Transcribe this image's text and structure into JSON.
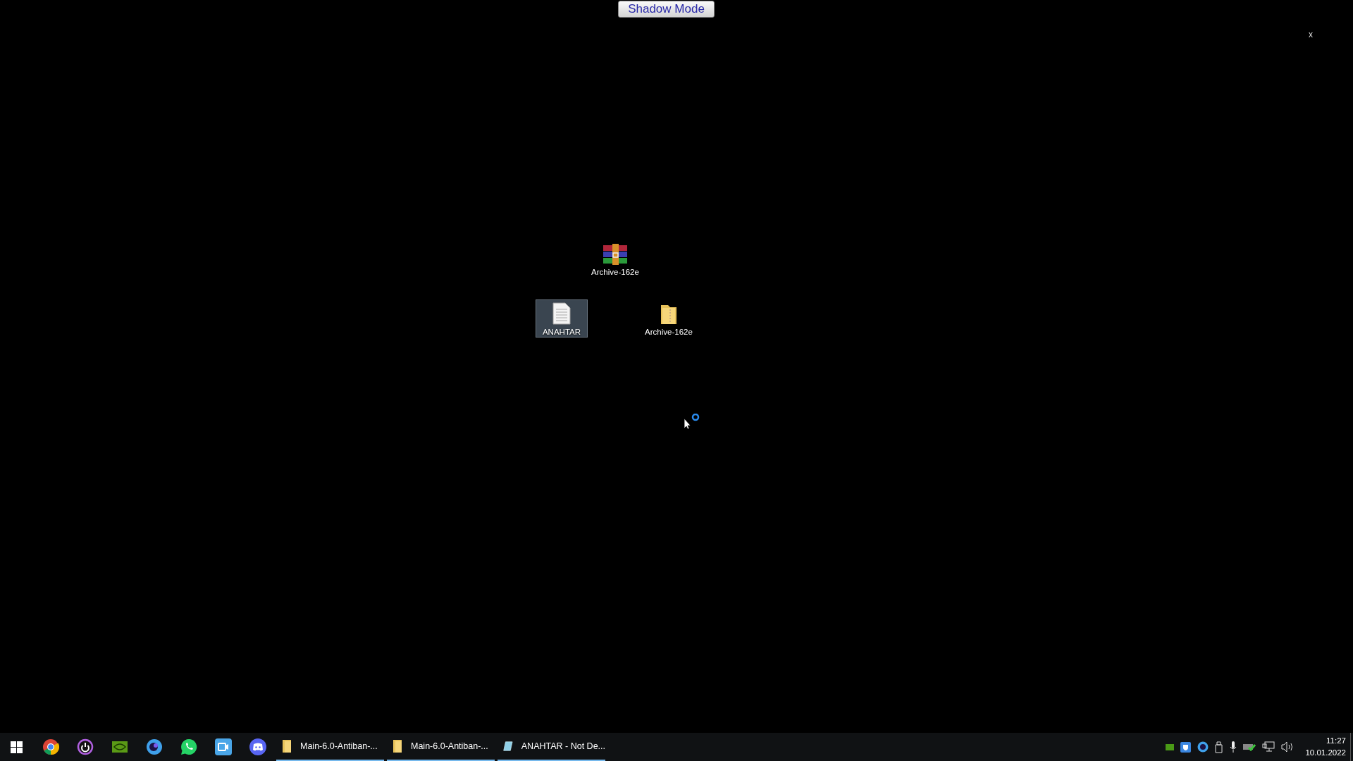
{
  "top_button": {
    "label": "Shadow Mode"
  },
  "close_label": "x",
  "desktop_icons": [
    {
      "kind": "archive",
      "label": "Archive-162e",
      "selected": false
    },
    {
      "kind": "text",
      "label": "ANAHTAR",
      "selected": true
    },
    {
      "kind": "folder",
      "label": "Archive-162e",
      "selected": false
    }
  ],
  "taskbar": {
    "pinned": [
      {
        "kind": "chrome"
      },
      {
        "kind": "ring"
      },
      {
        "kind": "green"
      },
      {
        "kind": "blue-eye"
      },
      {
        "kind": "phone"
      },
      {
        "kind": "camera"
      },
      {
        "kind": "chat"
      }
    ],
    "windows": [
      {
        "kind": "folder",
        "label": "Main-6.0-Antiban-..."
      },
      {
        "kind": "folder",
        "label": "Main-6.0-Antiban-..."
      },
      {
        "kind": "notepad",
        "label": "ANAHTAR - Not De..."
      }
    ],
    "tray": [
      {
        "kind": "green"
      },
      {
        "kind": "shield"
      },
      {
        "kind": "blue-eye"
      },
      {
        "kind": "usb"
      },
      {
        "kind": "mic"
      },
      {
        "kind": "check"
      },
      {
        "kind": "network"
      },
      {
        "kind": "volume"
      }
    ],
    "clock": {
      "time": "11:27",
      "date": "10.01.2022"
    }
  }
}
